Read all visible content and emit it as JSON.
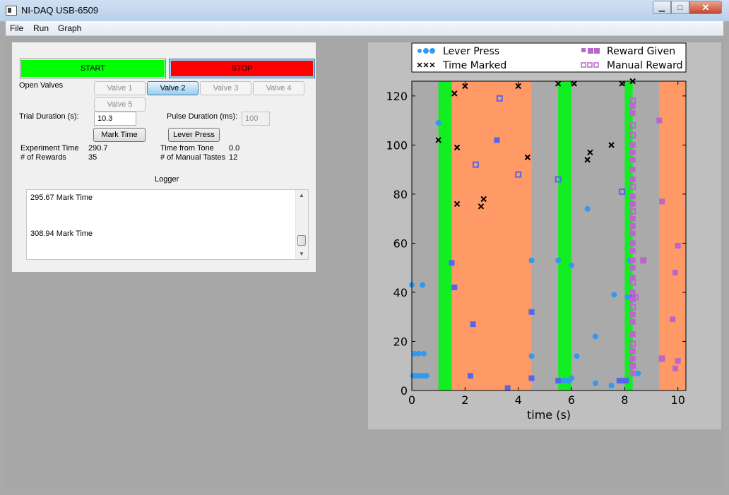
{
  "window": {
    "title": "NI-DAQ USB-6509",
    "minimize_glyph": "▁",
    "maximize_glyph": "□",
    "close_glyph": "✕"
  },
  "menu": [
    "File",
    "Run",
    "Graph"
  ],
  "controls": {
    "start_label": "START",
    "stop_label": "STOP",
    "open_valves_label": "Open Valves",
    "valves": [
      "Valve 1",
      "Valve 2",
      "Valve 3",
      "Valve 4",
      "Valve 5"
    ],
    "active_valve": "Valve 2",
    "trial_duration_label": "Trial Duration (s):",
    "trial_duration_value": "10.3",
    "pulse_duration_label": "Pulse Duration (ms):",
    "pulse_duration_value": "100",
    "mark_time_label": "Mark Time",
    "lever_press_label": "Lever Press",
    "experiment_time_label": "Experiment Time",
    "experiment_time_value": "290.7",
    "rewards_label": "# of Rewards",
    "rewards_value": "35",
    "time_from_tone_label": "Time from Tone",
    "time_from_tone_value": "0.0",
    "manual_tastes_label": "# of Manual Tastes",
    "manual_tastes_value": "12"
  },
  "logger": {
    "title": "Logger",
    "lines": [
      "295.67 Mark Time",
      "308.94 Mark Time"
    ]
  },
  "colors": {
    "start": "#00ff00",
    "stop": "#ff0000",
    "lever": "#3399ee",
    "lever_square": "#5566ee",
    "reward": "#bb66cc",
    "mark": "#000000",
    "green_band": "#11ee22",
    "orange_band": "#ff9966",
    "plot_bg": "#aaaaaa"
  },
  "chart_data": {
    "type": "scatter",
    "xlabel": "time (s)",
    "ylabel": "",
    "xlim": [
      0,
      10.3
    ],
    "ylim": [
      0,
      126
    ],
    "xticks": [
      0,
      2,
      4,
      6,
      8,
      10
    ],
    "yticks": [
      0,
      20,
      40,
      60,
      80,
      100,
      120
    ],
    "legend": {
      "placement": "top",
      "entries": [
        "Lever Press",
        "Time Marked",
        "Reward Given",
        "Manual Reward"
      ]
    },
    "green_bands": [
      [
        1.0,
        1.5
      ],
      [
        5.5,
        6.0
      ],
      [
        8.0,
        8.3
      ]
    ],
    "orange_bands": [
      [
        1.5,
        4.5
      ],
      [
        9.3,
        10.3
      ]
    ],
    "series": [
      {
        "name": "Lever Press",
        "marker": "circle",
        "points": [
          [
            0.0,
            43
          ],
          [
            0.4,
            43
          ],
          [
            0.1,
            15
          ],
          [
            0.25,
            15
          ],
          [
            0.45,
            15
          ],
          [
            0.05,
            6
          ],
          [
            0.15,
            6
          ],
          [
            0.25,
            6
          ],
          [
            0.35,
            6
          ],
          [
            0.45,
            6
          ],
          [
            0.55,
            6
          ],
          [
            1.0,
            109
          ],
          [
            4.5,
            53
          ],
          [
            4.5,
            32
          ],
          [
            4.5,
            14
          ],
          [
            4.5,
            5
          ],
          [
            5.5,
            53
          ],
          [
            6.0,
            51
          ],
          [
            5.6,
            4
          ],
          [
            5.7,
            4
          ],
          [
            5.8,
            4
          ],
          [
            5.9,
            4
          ],
          [
            6.0,
            5
          ],
          [
            6.2,
            14
          ],
          [
            6.6,
            74
          ],
          [
            7.6,
            39
          ],
          [
            6.9,
            22
          ],
          [
            6.9,
            3
          ],
          [
            7.5,
            2
          ],
          [
            8.2,
            53
          ],
          [
            8.1,
            38
          ],
          [
            8.3,
            13
          ],
          [
            8.3,
            7
          ],
          [
            8.5,
            7
          ]
        ]
      },
      {
        "name": "Lever Press squares",
        "marker": "square",
        "points": [
          [
            1.5,
            52
          ],
          [
            1.6,
            42
          ],
          [
            2.3,
            27
          ],
          [
            2.2,
            6
          ],
          [
            3.2,
            102
          ],
          [
            3.6,
            1
          ],
          [
            4.5,
            32
          ],
          [
            4.5,
            5
          ],
          [
            5.5,
            4
          ],
          [
            7.8,
            4
          ],
          [
            7.9,
            4
          ],
          [
            8.05,
            4
          ],
          [
            8.3,
            38
          ]
        ]
      },
      {
        "name": "Manual Lever squares",
        "marker": "open-square",
        "points": [
          [
            2.4,
            92
          ],
          [
            3.3,
            119
          ],
          [
            4.0,
            88
          ],
          [
            5.5,
            86
          ],
          [
            7.9,
            81
          ]
        ]
      },
      {
        "name": "Time Marked",
        "marker": "x",
        "points": [
          [
            1.0,
            102
          ],
          [
            1.6,
            121
          ],
          [
            1.7,
            99
          ],
          [
            1.7,
            76
          ],
          [
            2.0,
            124
          ],
          [
            2.6,
            75
          ],
          [
            2.7,
            78
          ],
          [
            4.0,
            124
          ],
          [
            4.35,
            95
          ],
          [
            5.5,
            125
          ],
          [
            6.1,
            125
          ],
          [
            6.6,
            94
          ],
          [
            6.7,
            97
          ],
          [
            7.5,
            100
          ],
          [
            7.9,
            125
          ],
          [
            8.3,
            126
          ]
        ]
      },
      {
        "name": "Reward Given",
        "marker": "square",
        "points": [
          [
            8.3,
            116
          ],
          [
            8.3,
            113
          ],
          [
            8.3,
            100
          ],
          [
            8.3,
            97
          ],
          [
            8.3,
            94
          ],
          [
            8.3,
            90
          ],
          [
            8.3,
            86
          ],
          [
            8.3,
            79
          ],
          [
            8.3,
            76
          ],
          [
            8.3,
            70
          ],
          [
            8.3,
            67
          ],
          [
            8.3,
            64
          ],
          [
            8.3,
            60
          ],
          [
            8.3,
            57
          ],
          [
            8.3,
            53
          ],
          [
            8.3,
            50
          ],
          [
            8.3,
            46
          ],
          [
            8.3,
            40
          ],
          [
            8.3,
            37
          ],
          [
            8.3,
            31
          ],
          [
            8.3,
            28
          ],
          [
            8.3,
            23
          ],
          [
            8.3,
            16
          ],
          [
            8.3,
            13
          ],
          [
            8.3,
            10
          ],
          [
            8.3,
            7
          ],
          [
            8.7,
            53
          ],
          [
            9.3,
            110
          ],
          [
            9.4,
            77
          ],
          [
            9.8,
            29
          ],
          [
            9.4,
            13
          ],
          [
            10.0,
            59
          ],
          [
            9.9,
            48
          ],
          [
            10.0,
            12
          ],
          [
            9.9,
            9
          ]
        ]
      },
      {
        "name": "Manual Reward",
        "marker": "open-square",
        "points": [
          [
            8.3,
            118
          ],
          [
            8.3,
            108
          ],
          [
            8.3,
            104
          ],
          [
            8.3,
            83
          ],
          [
            8.3,
            73
          ],
          [
            8.3,
            44
          ],
          [
            8.3,
            34
          ],
          [
            8.4,
            38
          ],
          [
            8.7,
            53
          ],
          [
            8.3,
            19
          ],
          [
            8.3,
            10
          ],
          [
            9.4,
            13
          ]
        ]
      }
    ]
  }
}
